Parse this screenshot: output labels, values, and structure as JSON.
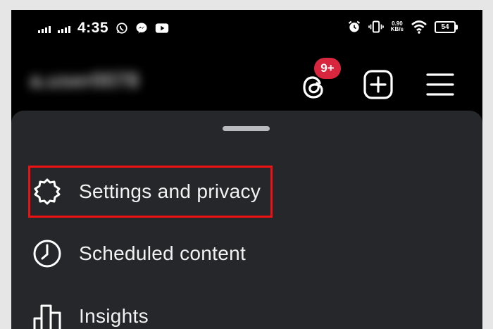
{
  "status_bar": {
    "time": "4:35",
    "signal_1_label": "",
    "signal_2_label": "",
    "network_speed_value": "0.90",
    "network_speed_unit": "KB/s",
    "battery": "54"
  },
  "header": {
    "username": "a.user0078"
  },
  "notifications": {
    "badge": "9+"
  },
  "menu": {
    "items": [
      {
        "label": "Settings and privacy"
      },
      {
        "label": "Scheduled content"
      },
      {
        "label": "Insights"
      }
    ]
  },
  "colors": {
    "background": "#000000",
    "sheet": "#26272b",
    "badge": "#d7263d",
    "highlight": "#ee1111"
  }
}
